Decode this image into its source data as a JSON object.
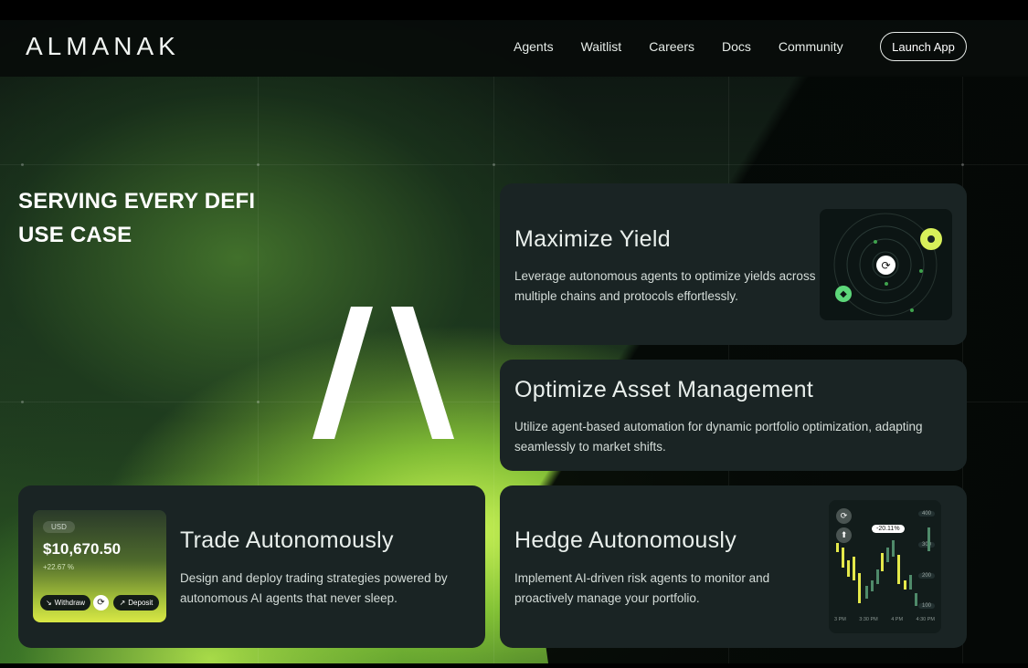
{
  "brand": {
    "logo_text": "ALMANAK"
  },
  "nav": {
    "links": [
      "Agents",
      "Waitlist",
      "Careers",
      "Docs",
      "Community"
    ],
    "launch_label": "Launch App"
  },
  "hero": {
    "headline_line1": "SERVING EVERY DEFI",
    "headline_line2": "USE CASE"
  },
  "cards": {
    "yield": {
      "title": "Maximize Yield",
      "description": "Leverage autonomous agents to optimize yields across multiple chains and protocols effortlessly."
    },
    "asset": {
      "title": "Optimize Asset Management",
      "description": "Utilize agent-based automation for dynamic portfolio optimization, adapting seamlessly to market shifts."
    },
    "trade": {
      "title": "Trade Autonomously",
      "description": "Design and deploy trading strategies powered by autonomous AI agents that never sleep.",
      "wallet": {
        "currency": "USD",
        "amount": "$10,670.50",
        "change": "+22.67 %",
        "withdraw_label": "Withdraw",
        "deposit_label": "Deposit"
      }
    },
    "hedge": {
      "title": "Hedge Autonomously",
      "description": "Implement AI-driven risk agents to monitor and proactively manage your portfolio.",
      "chart": {
        "badge": "-20.11%",
        "y_ticks": [
          "400",
          "300",
          "200",
          "100"
        ],
        "x_ticks": [
          "3 PM",
          "3:30 PM",
          "4 PM",
          "4:30 PM"
        ]
      }
    }
  },
  "colors": {
    "accent": "#d8f05a",
    "card_bg": "#1a2424",
    "nav_bg": "#080c0a"
  },
  "icons": [
    "swap-icon",
    "up-icon",
    "withdraw-arrow-icon",
    "deposit-arrow-icon",
    "refresh-icon",
    "ethereum-icon"
  ]
}
